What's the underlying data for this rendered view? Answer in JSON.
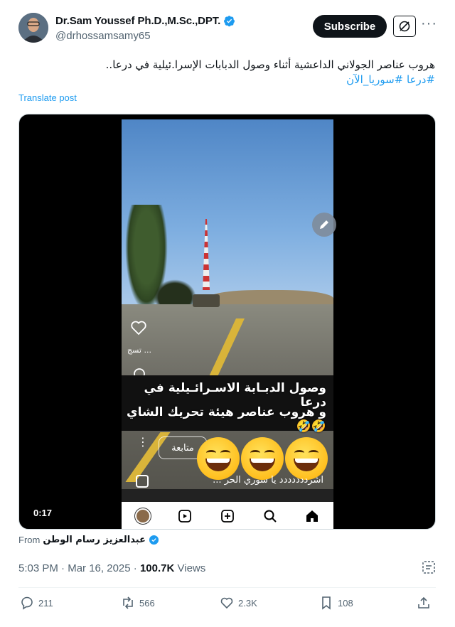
{
  "author": {
    "display_name": "Dr.Sam Youssef Ph.D.,M.Sc.,DPT.",
    "handle": "@drhossamsamy65",
    "verified": true
  },
  "header": {
    "subscribe_label": "Subscribe"
  },
  "tweet": {
    "text": "هروب عناصر الجولاني الداعشية أثناء وصول الدبابات الإسرا.ئيلية في درعا..",
    "hashtags": "#درعا #سوريا_الآن",
    "translate_label": "Translate post"
  },
  "video": {
    "duration": "0:17",
    "caption_line1": "وصول الدبـابة الاسـرائـيلية في درعا",
    "caption_line2": "و هروب عناصر هيئة تحريك الشاي🤣🤣",
    "follow_label": "متابعة",
    "original_caption": "اشرددددددد يا سوري الحر ...",
    "like_overlay_label": "تسج ..."
  },
  "source": {
    "from_label": "From",
    "from_name": "عبدالعزيز رسام الوطن"
  },
  "meta": {
    "time": "5:03 PM",
    "separator": "·",
    "date": "Mar 16, 2025",
    "views_count": "100.7K",
    "views_label": "Views"
  },
  "actions": {
    "replies": "211",
    "reposts": "566",
    "likes": "2.3K",
    "bookmarks": "108"
  },
  "colors": {
    "accent": "#1d9bf0",
    "text": "#0f1419",
    "secondary": "#536471"
  }
}
